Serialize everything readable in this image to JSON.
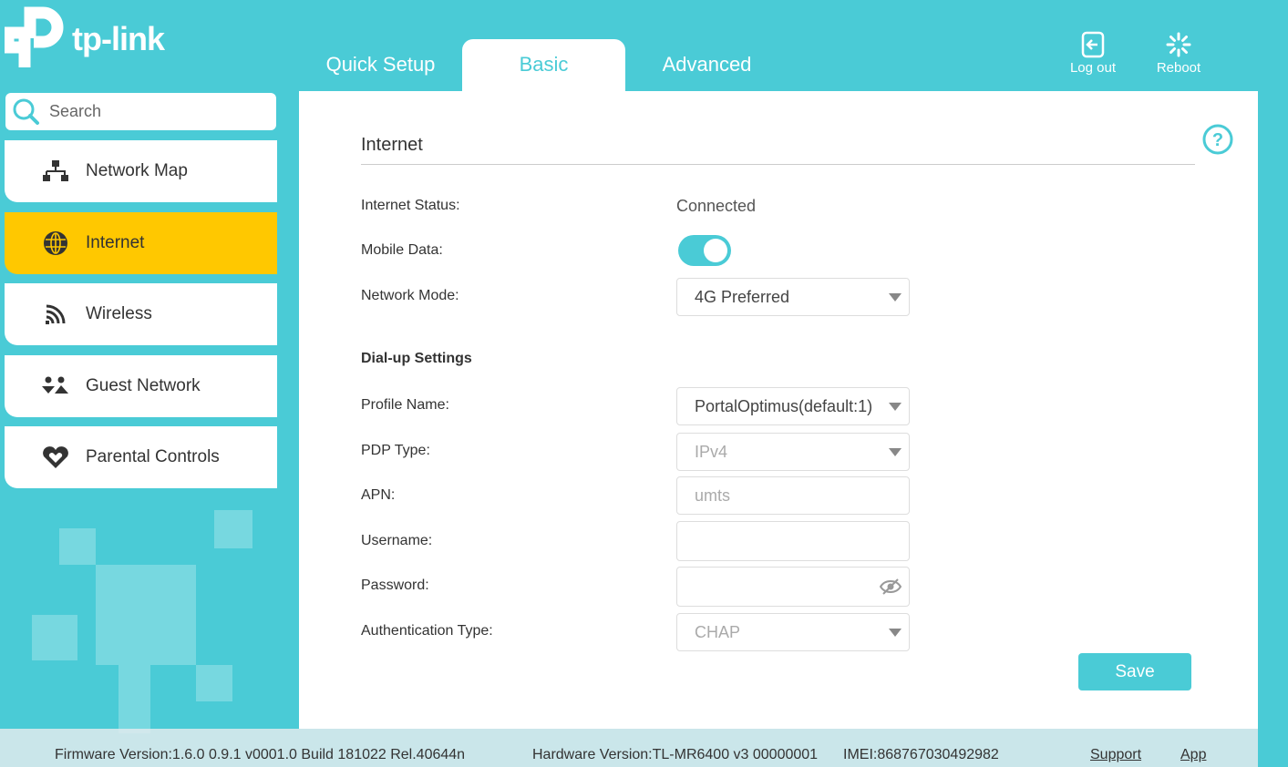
{
  "brand": {
    "name": "tp-link"
  },
  "tabs": [
    "Quick Setup",
    "Basic",
    "Advanced"
  ],
  "top": {
    "logout": "Log out",
    "reboot": "Reboot"
  },
  "search": {
    "placeholder": "Search"
  },
  "sidebar": {
    "items": [
      {
        "label": "Network Map"
      },
      {
        "label": "Internet"
      },
      {
        "label": "Wireless"
      },
      {
        "label": "Guest Network"
      },
      {
        "label": "Parental Controls"
      }
    ]
  },
  "main": {
    "title": "Internet",
    "status_label": "Internet Status:",
    "status_value": "Connected",
    "mobile_label": "Mobile Data:",
    "mobile_on": true,
    "mode_label": "Network Mode:",
    "mode_value": "4G Preferred",
    "dialup": "Dial-up Settings",
    "profile_label": "Profile Name:",
    "profile_value": "PortalOptimus(default:1)",
    "pdp_label": "PDP Type:",
    "pdp_value": "IPv4",
    "apn_label": "APN:",
    "apn_value": "umts",
    "user_label": "Username:",
    "user_value": "",
    "pass_label": "Password:",
    "pass_value": "",
    "auth_label": "Authentication Type:",
    "auth_value": "CHAP",
    "save": "Save"
  },
  "footer": {
    "firmware": "Firmware Version:1.6.0 0.9.1 v0001.0 Build 181022 Rel.40644n",
    "hardware": "Hardware Version:TL-MR6400 v3 00000001",
    "imei": "IMEI:868767030492982",
    "support": "Support",
    "app": "App"
  },
  "colors": {
    "accent": "#4acbd6",
    "active": "#ffc800"
  }
}
